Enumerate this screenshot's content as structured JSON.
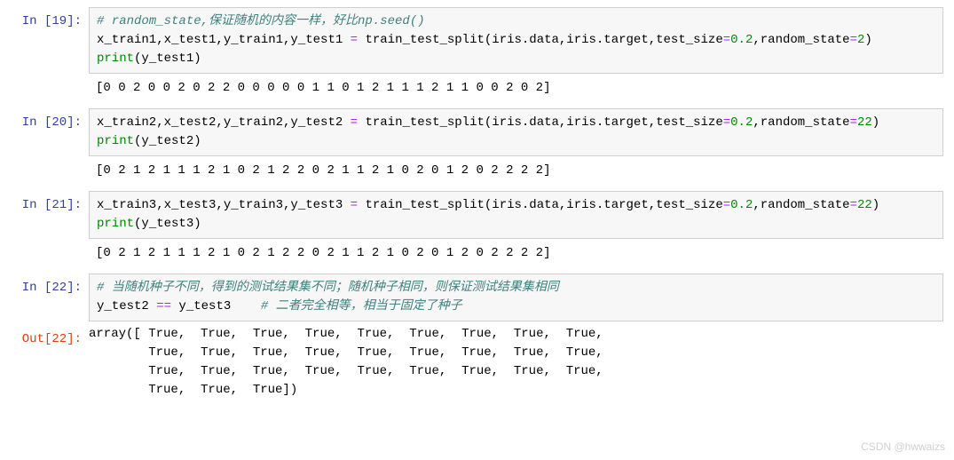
{
  "cells": [
    {
      "prompt_in": "In  [19]:",
      "code_line1_comment": "# random_state,保证随机的内容一样，好比np.seed()",
      "code_line2_lhs": "x_train1,x_test1,y_train1,y_test1 ",
      "code_line2_eq": "=",
      "code_line2_fn": " train_test_split(iris.data,iris.target,test_size",
      "code_line2_eq2": "=",
      "code_line2_v1": "0.2",
      "code_line2_mid": ",random_state",
      "code_line2_eq3": "=",
      "code_line2_v2": "2",
      "code_line2_end": ")",
      "code_line3_fn": "print",
      "code_line3_args": "(y_test1)",
      "output": "[0 0 2 0 0 2 0 2 2 0 0 0 0 0 1 1 0 1 2 1 1 1 2 1 1 0 0 2 0 2]"
    },
    {
      "prompt_in": "In  [20]:",
      "code_line1_lhs": "x_train2,x_test2,y_train2,y_test2 ",
      "code_line1_eq": "=",
      "code_line1_fn": " train_test_split(iris.data,iris.target,test_size",
      "code_line1_eq2": "=",
      "code_line1_v1": "0.2",
      "code_line1_mid": ",random_state",
      "code_line1_eq3": "=",
      "code_line1_v2": "22",
      "code_line1_end": ")",
      "code_line2_fn": "print",
      "code_line2_args": "(y_test2)",
      "output": "[0 2 1 2 1 1 1 2 1 0 2 1 2 2 0 2 1 1 2 1 0 2 0 1 2 0 2 2 2 2]"
    },
    {
      "prompt_in": "In  [21]:",
      "code_line1_lhs": "x_train3,x_test3,y_train3,y_test3 ",
      "code_line1_eq": "=",
      "code_line1_fn": " train_test_split(iris.data,iris.target,test_size",
      "code_line1_eq2": "=",
      "code_line1_v1": "0.2",
      "code_line1_mid": ",random_state",
      "code_line1_eq3": "=",
      "code_line1_v2": "22",
      "code_line1_end": ")",
      "code_line2_fn": "print",
      "code_line2_args": "(y_test3)",
      "output": "[0 2 1 2 1 1 1 2 1 0 2 1 2 2 0 2 1 1 2 1 0 2 0 1 2 0 2 2 2 2]"
    },
    {
      "prompt_in": "In  [22]:",
      "code_line1_comment": "# 当随机种子不同，得到的测试结果集不同；随机种子相同，则保证测试结果集相同",
      "code_line2_lhs": "y_test2 ",
      "code_line2_eq": "==",
      "code_line2_rhs": " y_test3    ",
      "code_line2_comment": "# 二者完全相等，相当于固定了种子",
      "prompt_out": "Out[22]:",
      "output": "array([ True,  True,  True,  True,  True,  True,  True,  True,  True,\n        True,  True,  True,  True,  True,  True,  True,  True,  True,\n        True,  True,  True,  True,  True,  True,  True,  True,  True,\n        True,  True,  True])"
    }
  ],
  "watermark": "CSDN @hwwaizs"
}
